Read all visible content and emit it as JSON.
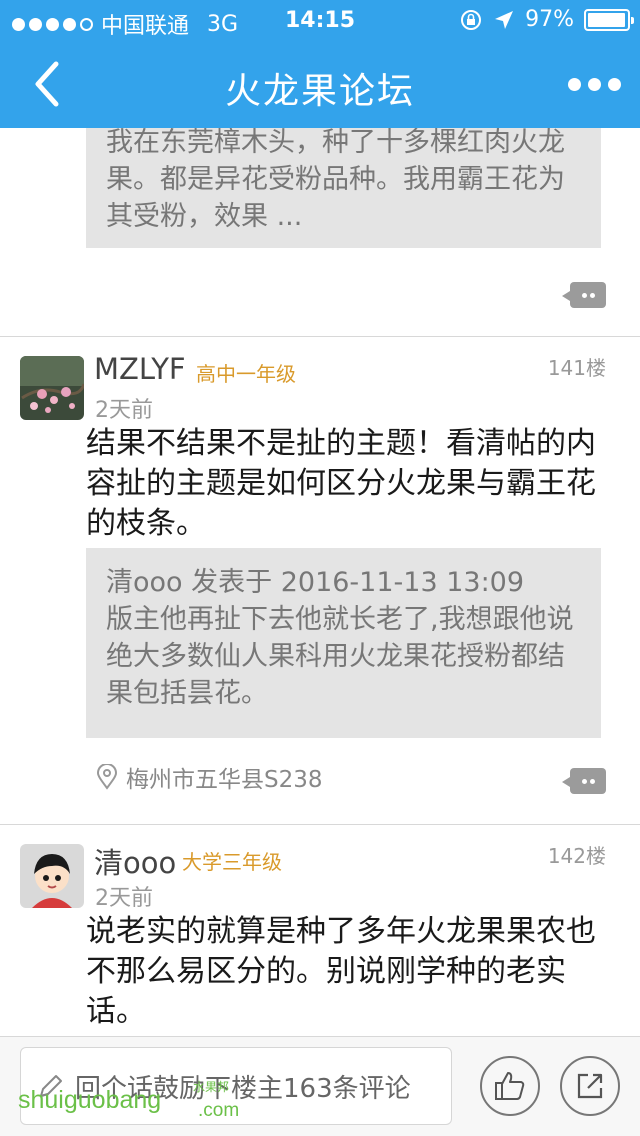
{
  "status_bar": {
    "carrier": "中国联通",
    "network": "3G",
    "time": "14:15",
    "battery": "97%",
    "battery_level": 0.97
  },
  "nav": {
    "title": "火龙果论坛",
    "back_icon": "chevron-left-icon",
    "more_icon": "more-dots-icon"
  },
  "partial_post": {
    "quote_text": "我在东莞樟木头，种了十多棵红肉火龙果。都是异花受粉品种。我用霸王花为其受粉，效果 ..."
  },
  "posts": [
    {
      "username": "MZLYF",
      "level": "高中一年级",
      "floor": "141楼",
      "time": "2天前",
      "text": "结果不结果不是扯的主题！看清帖的内容扯的主题是如何区分火龙果与霸王花的枝条。",
      "quote_header": "清ooo 发表于 2016-11-13 13:09",
      "quote_text": "版主他再扯下去他就长老了,我想跟他说绝大多数仙人果科用火龙果花授粉都结果包括昙花。",
      "location": "梅州市五华县S238"
    },
    {
      "username": "清ooo",
      "level": "大学三年级",
      "floor": "142楼",
      "time": "2天前",
      "text": "说老实的就算是种了多年火龙果果农也不那么易区分的。别说刚学种的老实话。"
    }
  ],
  "bottom_bar": {
    "reply_placeholder": "回个话鼓励下楼主163条评论",
    "like_icon": "thumbs-up-icon",
    "share_icon": "share-icon"
  },
  "watermark": {
    "text": "shuiguobang",
    "sub": "水果邦",
    "domain": ".com"
  },
  "colors": {
    "header": "#33a3eb",
    "level": "#d99a2b",
    "watermark": "#6bc048"
  }
}
